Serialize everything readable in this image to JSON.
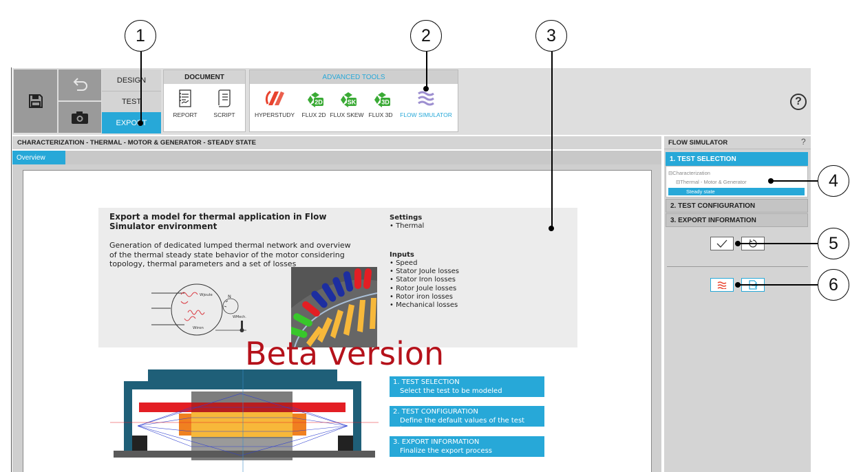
{
  "toolbar": {
    "nav": {
      "design": "DESIGN",
      "test": "TEST",
      "export": "EXPORT"
    },
    "document": {
      "title": "DOCUMENT",
      "report": "REPORT",
      "script": "SCRIPT"
    },
    "advanced": {
      "title": "ADVANCED TOOLS",
      "hyperstudy": "HYPERSTUDY",
      "flux2d": "FLUX 2D",
      "fluxskew": "FLUX SKEW",
      "flux3d": "FLUX 3D",
      "flowsim": "FLOW SIMULATOR"
    },
    "icons": {
      "flux2d": "2D",
      "fluxskew": "SK",
      "flux3d": "3D"
    },
    "help": "?"
  },
  "main": {
    "title": "CHARACTERIZATION - THERMAL - MOTOR & GENERATOR - STEADY STATE",
    "tab": "Overview"
  },
  "overview": {
    "heading": "Export a model for thermal application in Flow Simulator environment",
    "description": "Generation of dedicated lumped thermal network and overview of the thermal steady state behavior of the motor considering topology, thermal parameters and a set of losses",
    "settings_title": "Settings",
    "settings": [
      "Thermal"
    ],
    "inputs_title": "Inputs",
    "inputs": [
      "Speed",
      "Stator Joule losses",
      "Stator Iron losses",
      "Rotor Joule losses",
      "Rotor iron losses",
      "Mechanical losses"
    ],
    "diagram_labels": {
      "wjoule": "Wjoule",
      "n": "N",
      "wmech": "WMech.",
      "wiron": "Wiron"
    },
    "beta": "Beta version",
    "steps": [
      {
        "title": "1. TEST SELECTION",
        "desc": "Select the test to be modeled"
      },
      {
        "title": "2. TEST CONFIGURATION",
        "desc": "Define the default values of the test inputs"
      },
      {
        "title": "3. EXPORT INFORMATION",
        "desc": "Finalize the export process"
      }
    ]
  },
  "side_panel": {
    "title": "FLOW SIMULATOR",
    "help": "?",
    "sections": {
      "selection": "1. TEST SELECTION",
      "configuration": "2. TEST CONFIGURATION",
      "export": "3. EXPORT INFORMATION"
    },
    "tree": {
      "root": "Characterization",
      "child": "Thermal - Motor & Generator",
      "leaf": "Steady state"
    }
  },
  "callouts": [
    "1",
    "2",
    "3",
    "4",
    "5",
    "6"
  ],
  "colors": {
    "accent": "#27a8d8",
    "beta": "#b5121b",
    "flux_green": "#3aaa35",
    "hyperstudy": "#e8432e",
    "flowsim": "#9d8fd0"
  }
}
